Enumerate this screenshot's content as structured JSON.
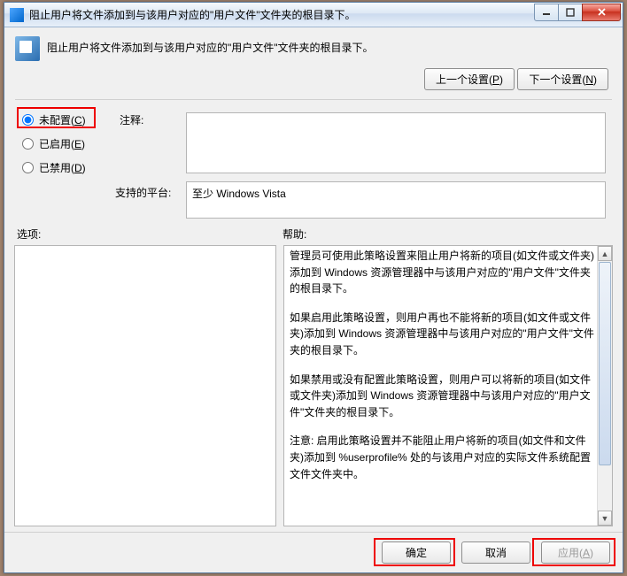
{
  "window": {
    "title": "阻止用户将文件添加到与该用户对应的\"用户文件\"文件夹的根目录下。"
  },
  "header": {
    "description": "阻止用户将文件添加到与该用户对应的\"用户文件\"文件夹的根目录下。"
  },
  "nav": {
    "prev": "上一个设置(",
    "prev_accel": "P",
    "prev_suffix": ")",
    "next": "下一个设置(",
    "next_accel": "N",
    "next_suffix": ")"
  },
  "radios": {
    "not_configured": "未配置(",
    "not_configured_accel": "C",
    "enabled": "已启用(",
    "enabled_accel": "E",
    "disabled": "已禁用(",
    "disabled_accel": "D",
    "suffix": ")"
  },
  "labels": {
    "comment": "注释:",
    "platform": "支持的平台:",
    "options": "选项:",
    "help": "帮助:"
  },
  "platform_text": "至少 Windows Vista",
  "help_paragraphs": [
    "管理员可使用此策略设置来阻止用户将新的项目(如文件或文件夹)添加到 Windows 资源管理器中与该用户对应的\"用户文件\"文件夹的根目录下。",
    "如果启用此策略设置，则用户再也不能将新的项目(如文件或文件夹)添加到 Windows 资源管理器中与该用户对应的\"用户文件\"文件夹的根目录下。",
    "如果禁用或没有配置此策略设置，则用户可以将新的项目(如文件或文件夹)添加到 Windows 资源管理器中与该用户对应的\"用户文件\"文件夹的根目录下。",
    "注意: 启用此策略设置并不能阻止用户将新的项目(如文件和文件夹)添加到 %userprofile% 处的与该用户对应的实际文件系统配置文件文件夹中。"
  ],
  "footer": {
    "ok": "确定",
    "cancel": "取消",
    "apply": "应用(",
    "apply_accel": "A",
    "apply_suffix": ")"
  }
}
